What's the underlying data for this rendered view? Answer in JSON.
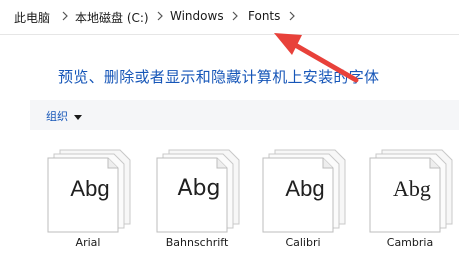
{
  "breadcrumb": {
    "items": [
      "此电脑",
      "本地磁盘 (C:)",
      "Windows",
      "Fonts"
    ],
    "separator_icon": "chevron-right-icon"
  },
  "main": {
    "heading": "预览、删除或者显示和隐藏计算机上安装的字体"
  },
  "toolbar": {
    "organize_label": "组织",
    "organize_icon": "caret-down-icon"
  },
  "fonts": [
    {
      "sample": "Abg",
      "name": "Arial"
    },
    {
      "sample": "Abg",
      "name": "Bahnschrift"
    },
    {
      "sample": "Abg",
      "name": "Calibri"
    },
    {
      "sample": "Abg",
      "name": "Cambria"
    }
  ],
  "annotation": {
    "arrow_color": "#e8413a",
    "arrow_icon": "red-arrow-icon"
  },
  "colors": {
    "link": "#1656b8",
    "toolbar_bg": "#f5f6f8"
  }
}
